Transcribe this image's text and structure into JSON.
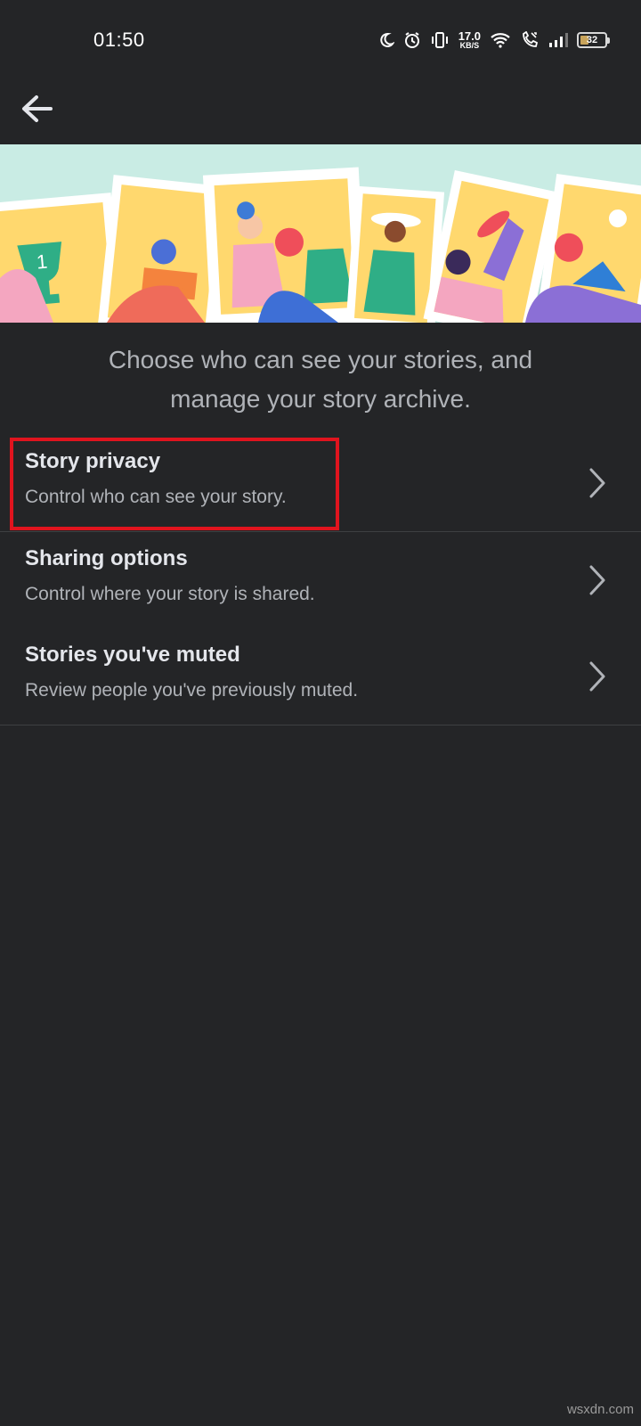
{
  "status_bar": {
    "time": "01:50",
    "net_speed_value": "17.0",
    "net_speed_unit": "KB/S",
    "battery": "32",
    "icons": [
      "moon-icon",
      "alarm-icon",
      "vibrate-icon",
      "wifi-icon",
      "volte-call-icon",
      "signal-icon",
      "battery-icon"
    ]
  },
  "header": {
    "back_icon": "arrow-left-icon"
  },
  "banner": {
    "description_icon": "stories-illustration"
  },
  "intro": {
    "line1": "Choose who can see your stories, and",
    "line2": "manage your story archive."
  },
  "settings": {
    "items": [
      {
        "title": "Story privacy",
        "description": "Control who can see your story."
      },
      {
        "title": "Sharing options",
        "description": "Control where your story is shared."
      },
      {
        "title": "Stories you've muted",
        "description": "Review people you've previously muted."
      }
    ]
  },
  "highlight_color": "#e0141e",
  "watermark": "wsxdn.com"
}
